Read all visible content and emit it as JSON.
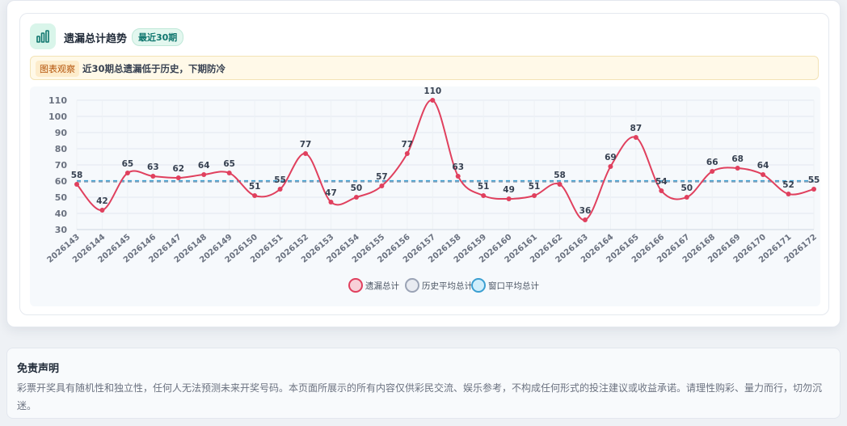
{
  "header": {
    "title": "遗漏总计趋势",
    "badge": "最近30期"
  },
  "insight": {
    "tag": "图表观察",
    "text": "近30期总遗漏低于历史，下期防冷"
  },
  "colors": {
    "series_line": "#e0405e",
    "history_avg": "#9aa3b5",
    "window_avg": "#3b9fd1",
    "accent": "#0f766e"
  },
  "chart_data": {
    "type": "line",
    "title": "",
    "xlabel": "",
    "ylabel": "",
    "ylim": [
      30,
      110
    ],
    "yticks": [
      30,
      40,
      50,
      60,
      70,
      80,
      90,
      100,
      110
    ],
    "grid": true,
    "legend_position": "bottom-center",
    "categories": [
      "2026143",
      "2026144",
      "2026145",
      "2026146",
      "2026147",
      "2026148",
      "2026149",
      "2026150",
      "2026151",
      "2026152",
      "2026153",
      "2026154",
      "2026155",
      "2026156",
      "2026157",
      "2026158",
      "2026159",
      "2026160",
      "2026161",
      "2026162",
      "2026163",
      "2026164",
      "2026165",
      "2026166",
      "2026167",
      "2026168",
      "2026169",
      "2026170",
      "2026171",
      "2026172"
    ],
    "series": [
      {
        "name": "遗漏总计",
        "values": [
          58,
          42,
          65,
          63,
          62,
          64,
          65,
          51,
          55,
          77,
          47,
          50,
          57,
          77,
          110,
          63,
          51,
          49,
          51,
          58,
          36,
          69,
          87,
          54,
          50,
          66,
          68,
          64,
          52,
          55
        ],
        "labels": [
          58,
          42,
          65,
          63,
          62,
          64,
          65,
          51,
          55,
          77,
          47,
          50,
          57,
          77,
          110,
          63,
          51,
          49,
          51,
          58,
          36,
          69,
          87,
          54,
          50,
          66,
          68,
          64,
          52,
          55
        ]
      },
      {
        "name": "历史平均总计",
        "values": [
          59.5,
          59.5,
          59.5,
          59.5,
          59.5,
          59.5,
          59.5,
          59.5,
          59.5,
          59.5,
          59.5,
          59.5,
          59.5,
          59.5,
          59.5,
          59.5,
          59.5,
          59.5,
          59.5,
          59.5,
          59.5,
          59.5,
          59.5,
          59.5,
          59.5,
          59.5,
          59.5,
          59.5,
          59.5,
          59.5
        ]
      },
      {
        "name": "窗口平均总计",
        "values": [
          60.2,
          60.2,
          60.2,
          60.2,
          60.2,
          60.2,
          60.2,
          60.2,
          60.2,
          60.2,
          60.2,
          60.2,
          60.2,
          60.2,
          60.2,
          60.2,
          60.2,
          60.2,
          60.2,
          60.2,
          60.2,
          60.2,
          60.2,
          60.2,
          60.2,
          60.2,
          60.2,
          60.2,
          60.2,
          60.2
        ]
      }
    ]
  },
  "disclaimer": {
    "title": "免责声明",
    "text": "彩票开奖具有随机性和独立性，任何人无法预测未来开奖号码。本页面所展示的所有内容仅供彩民交流、娱乐参考，不构成任何形式的投注建议或收益承诺。请理性购彩、量力而行，切勿沉迷。"
  }
}
